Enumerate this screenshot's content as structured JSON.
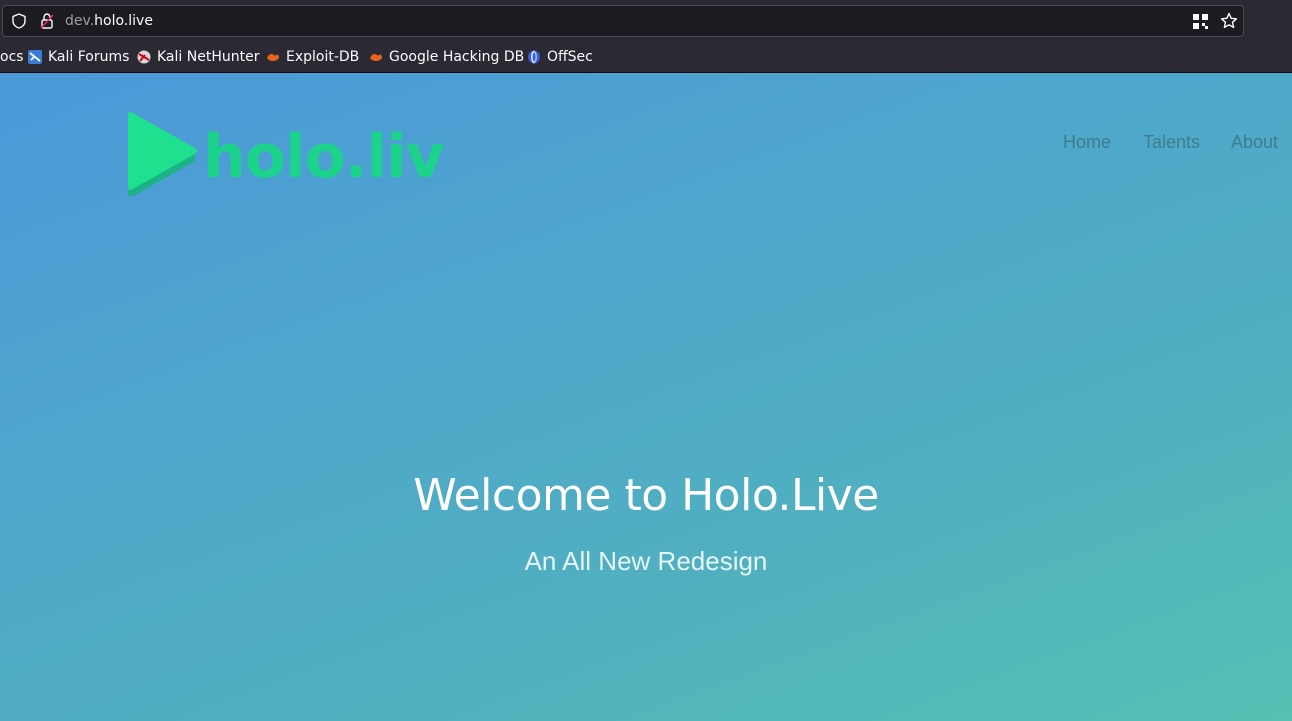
{
  "browser": {
    "url_subdomain": "dev.",
    "url_domain": "holo.live",
    "bookmarks": [
      {
        "label": "ocs",
        "icon": "docs-icon"
      },
      {
        "label": "Kali Forums",
        "icon": "kali-forums-icon"
      },
      {
        "label": "Kali NetHunter",
        "icon": "kali-nethunter-icon"
      },
      {
        "label": "Exploit-DB",
        "icon": "exploit-db-icon"
      },
      {
        "label": "Google Hacking DB",
        "icon": "google-hacking-db-icon"
      },
      {
        "label": "OffSec",
        "icon": "offsec-icon"
      }
    ]
  },
  "site": {
    "logo_text": "holo.live",
    "nav": [
      "Home",
      "Talents",
      "About"
    ],
    "hero_title": "Welcome to Holo.Live",
    "hero_subtitle": "An All New Redesign"
  },
  "colors": {
    "logo_green": "#1bd38a",
    "nav_text": "#3f7c8d",
    "hero_text": "#ffffff"
  }
}
